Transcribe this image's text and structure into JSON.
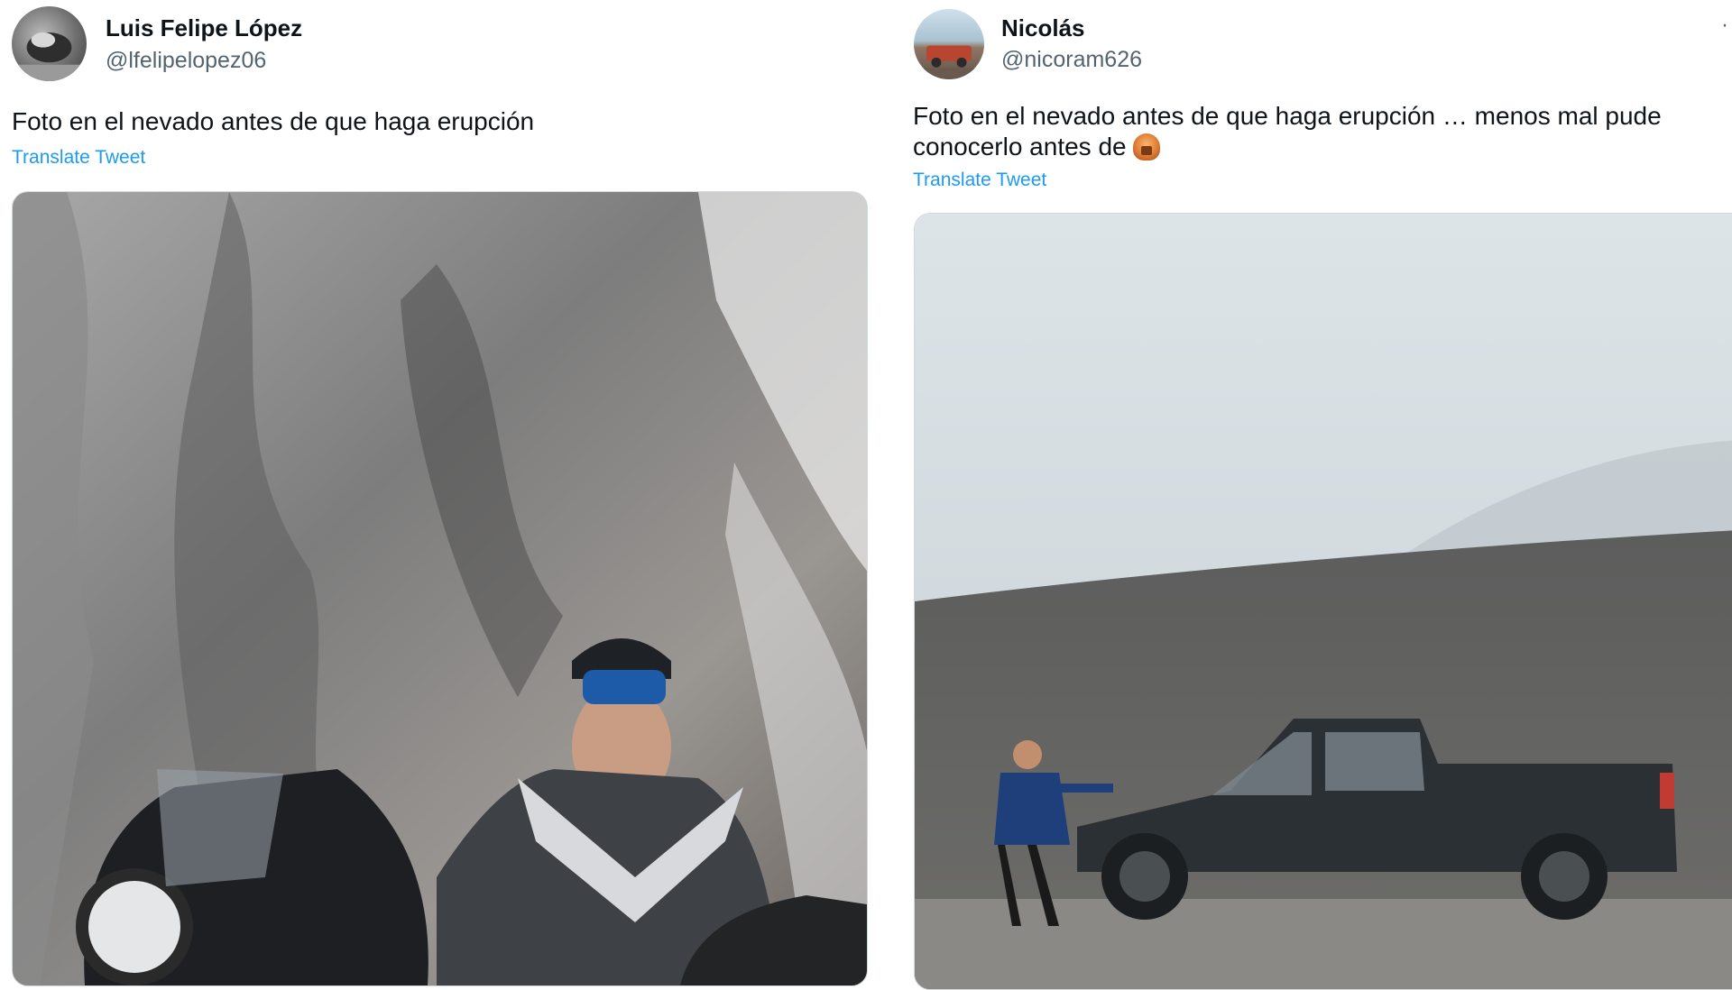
{
  "tweets": [
    {
      "author_name": "Luis Felipe López",
      "handle": "@lfelipelopez06",
      "text": "Foto en el nevado antes de que haga erupción",
      "translate_label": "Translate Tweet",
      "avatar_icon": "user-avatar",
      "media_description_icon": "photo"
    },
    {
      "author_name": "Nicolás",
      "handle": "@nicoram626",
      "text": "Foto en el nevado antes de que haga erupción … menos mal pude conocerlo antes de",
      "emoji": "🫣",
      "translate_label": "Translate Tweet",
      "more_label": "·",
      "avatar_icon": "user-avatar",
      "media_description_icon": "photo"
    }
  ],
  "colors": {
    "link": "#1d9bf0",
    "secondary_text": "#536471",
    "primary_text": "#0f1419",
    "border": "#cfd9de"
  }
}
